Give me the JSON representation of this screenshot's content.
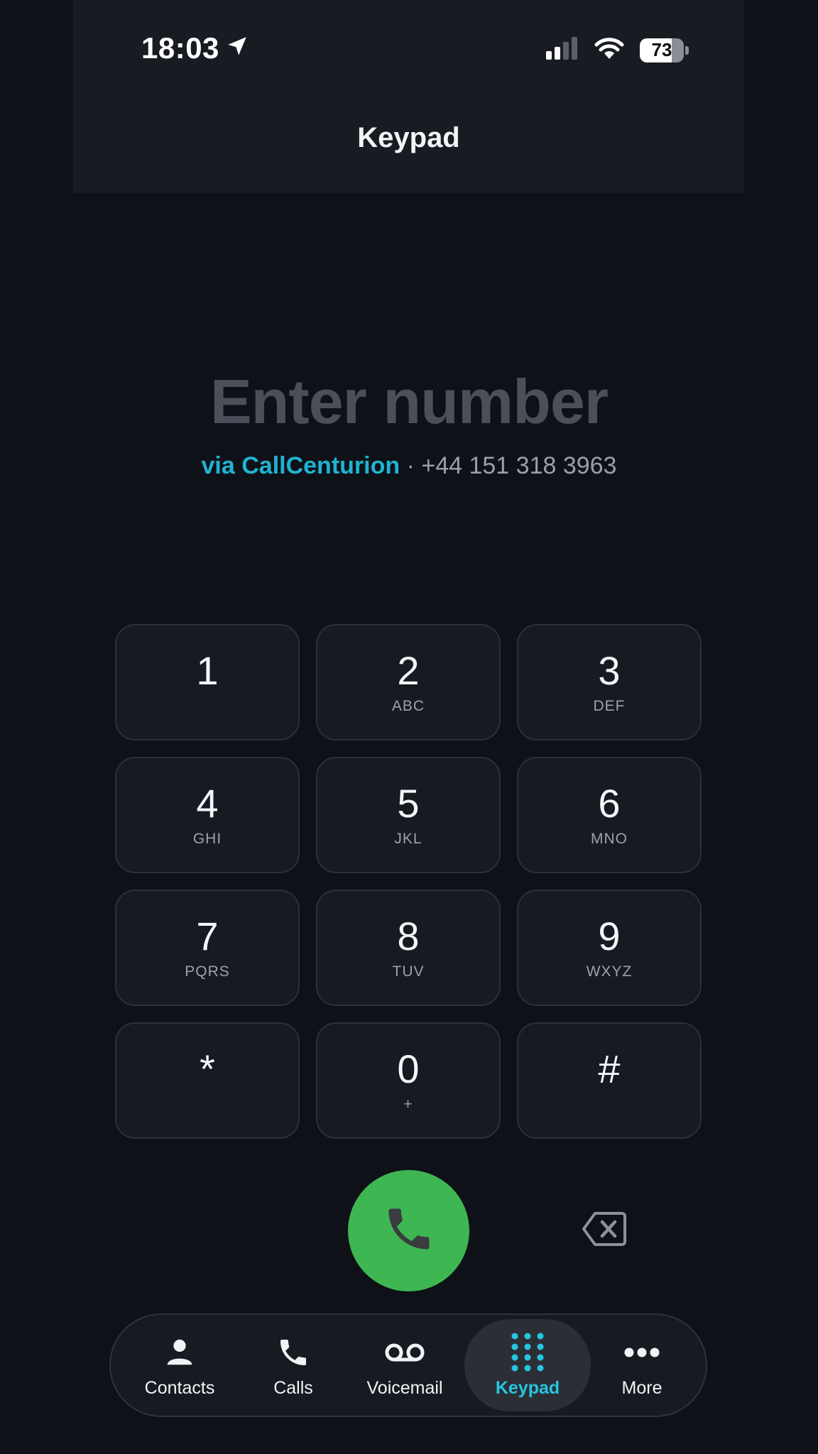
{
  "status_bar": {
    "time": "18:03",
    "battery_level": "73",
    "battery_fraction": 0.73
  },
  "header": {
    "title": "Keypad"
  },
  "dialer": {
    "placeholder": "Enter number",
    "via_label": "via CallCenturion",
    "separator": "·",
    "caller_number": "+44 151 318 3963"
  },
  "keypad": {
    "keys": [
      {
        "digit": "1",
        "letters": ""
      },
      {
        "digit": "2",
        "letters": "ABC"
      },
      {
        "digit": "3",
        "letters": "DEF"
      },
      {
        "digit": "4",
        "letters": "GHI"
      },
      {
        "digit": "5",
        "letters": "JKL"
      },
      {
        "digit": "6",
        "letters": "MNO"
      },
      {
        "digit": "7",
        "letters": "PQRS"
      },
      {
        "digit": "8",
        "letters": "TUV"
      },
      {
        "digit": "9",
        "letters": "WXYZ"
      },
      {
        "digit": "*",
        "letters": ""
      },
      {
        "digit": "0",
        "letters": "+"
      },
      {
        "digit": "#",
        "letters": ""
      }
    ]
  },
  "actions": {
    "call_icon": "phone-icon",
    "backspace_icon": "backspace-icon"
  },
  "tab_bar": {
    "active": "Keypad",
    "accent_color": "#26c6e0",
    "tabs": [
      {
        "label": "Contacts",
        "icon": "person-icon"
      },
      {
        "label": "Calls",
        "icon": "phone-icon"
      },
      {
        "label": "Voicemail",
        "icon": "voicemail-icon"
      },
      {
        "label": "Keypad",
        "icon": "keypad-dots-icon"
      },
      {
        "label": "More",
        "icon": "more-dots-icon"
      }
    ]
  },
  "colors": {
    "call_green": "#3eb651",
    "via_accent": "#1fb3d2"
  }
}
